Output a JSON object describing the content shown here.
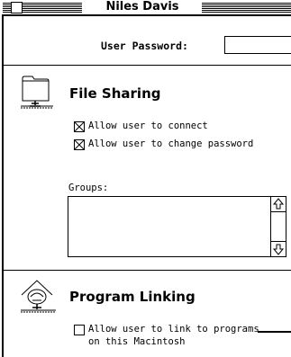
{
  "window": {
    "title": "Niles Davis"
  },
  "password": {
    "label": "User Password:",
    "value": ""
  },
  "file_sharing": {
    "heading": "File Sharing",
    "icon": "file-sharing-folder-icon",
    "options": [
      {
        "label": "Allow user to connect",
        "checked": true
      },
      {
        "label": "Allow user to change password",
        "checked": true
      }
    ],
    "groups_label": "Groups:"
  },
  "program_linking": {
    "heading": "Program Linking",
    "icon": "program-linking-icon",
    "option_line1": "Allow user to link to programs",
    "option_line2": "on this Macintosh",
    "checked": false
  }
}
